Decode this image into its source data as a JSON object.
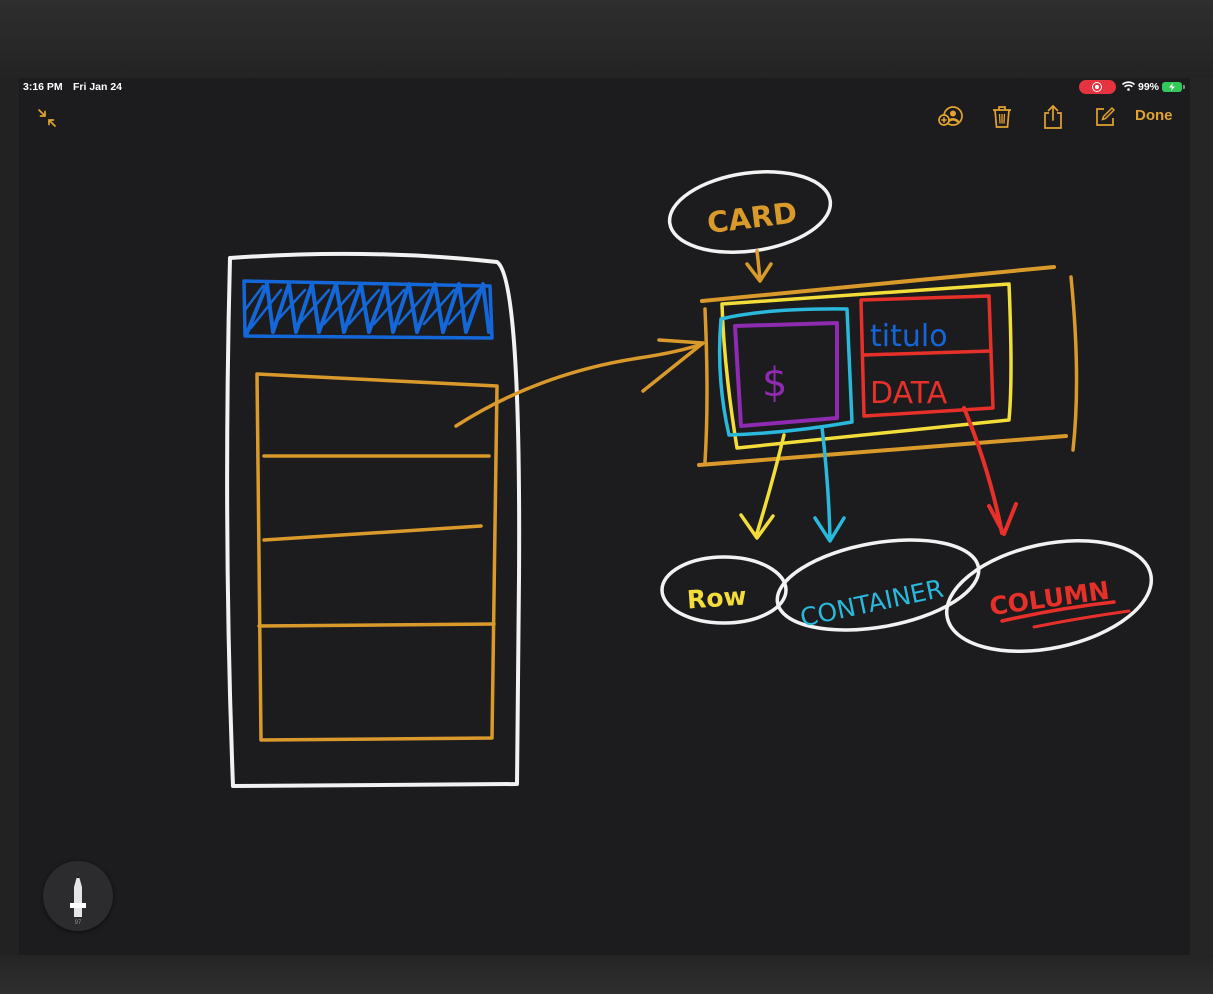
{
  "status_bar": {
    "time": "3:16 PM",
    "date": "Fri Jan 24",
    "battery": "99%",
    "record_color": "#e5333f",
    "battery_color": "#34c759"
  },
  "toolbar": {
    "collapse_icon": "arrows-collapse-icon",
    "icons": [
      "add-collaborator-icon",
      "trash-icon",
      "share-icon",
      "compose-icon"
    ],
    "done_label": "Done",
    "accent": "#e3a330"
  },
  "drawing": {
    "labels": {
      "card": "CARD",
      "titulo": "titulo",
      "dollar": "$",
      "data": "DATA",
      "row": "Row",
      "container": "CONTAINER",
      "column": "COLUMN"
    },
    "colors": {
      "white": "#f2f2f2",
      "orange": "#d99a2b",
      "blue": "#1467d8",
      "yellow": "#f3dd3a",
      "cyan": "#2ab8dc",
      "purple": "#8e2bb0",
      "red": "#e8302a"
    }
  },
  "pencil_tool": {
    "size": "97"
  }
}
